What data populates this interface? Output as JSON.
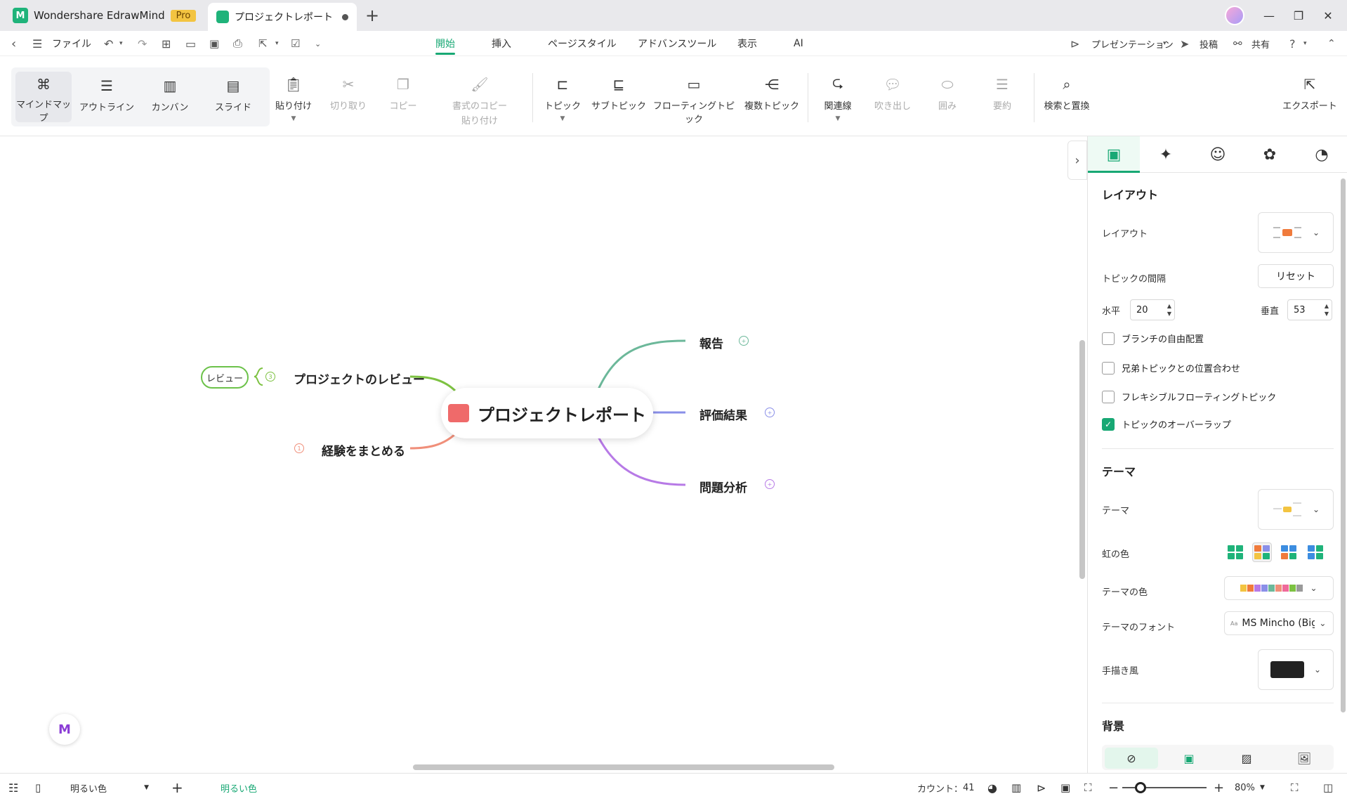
{
  "titlebar": {
    "app_name": "Wondershare EdrawMind",
    "pro_badge": "Pro",
    "doc_tab": "プロジェクトレポート",
    "new_tab": "+",
    "window_controls": {
      "minimize": "—",
      "restore": "❐",
      "close": "✕"
    }
  },
  "menubar": {
    "file": "ファイル",
    "tabs": [
      "開始",
      "挿入",
      "ページスタイル",
      "アドバンスツール",
      "表示",
      "AI"
    ],
    "active_tab": "開始",
    "presentation": "プレゼンテーション",
    "post": "投稿",
    "share": "共有"
  },
  "ribbon": {
    "views": [
      "マインドマップ",
      "アウトライン",
      "カンバン",
      "スライド"
    ],
    "paste": "貼り付け",
    "cut": "切り取り",
    "copy": "コピー",
    "format_copy_line1": "書式のコピー",
    "format_copy_line2": "貼り付け",
    "topic": "トピック",
    "subtopic": "サブトピック",
    "floating_topic": "フローティングトピック",
    "multiple_topics": "複数トピック",
    "relationship": "関連線",
    "callout": "吹き出し",
    "boundary": "囲み",
    "summary": "要約",
    "find_replace": "検索と置換",
    "export": "エクスポート"
  },
  "mindmap": {
    "root": "プロジェクトレポート",
    "topics": {
      "report": "報告",
      "evaluation": "評価結果",
      "analysis": "問題分析",
      "review": "プロジェクトのレビュー",
      "summary": "経験をまとめる"
    },
    "callout_label": "レビュー",
    "colors": {
      "report": "#6cb89a",
      "evaluation": "#8a8fe8",
      "analysis": "#b77ae6",
      "review": "#7dc242",
      "summary": "#f08f7a"
    }
  },
  "panel": {
    "tab_icons": [
      "layout-icon",
      "ai-sparkle-icon",
      "emoji-icon",
      "badge-icon",
      "history-icon"
    ],
    "layout_heading": "レイアウト",
    "layout_label": "レイアウト",
    "spacing_label": "トピックの間隔",
    "reset_button": "リセット",
    "horizontal_label": "水平",
    "horizontal_value": "20",
    "vertical_label": "垂直",
    "vertical_value": "53",
    "checkboxes": [
      {
        "label": "ブランチの自由配置",
        "checked": false
      },
      {
        "label": "兄弟トピックとの位置合わせ",
        "checked": false
      },
      {
        "label": "フレキシブルフローティングトピック",
        "checked": false
      },
      {
        "label": "トピックのオーバーラップ",
        "checked": true
      }
    ],
    "theme_heading": "テーマ",
    "theme_label": "テーマ",
    "rainbow_label": "虹の色",
    "theme_color_label": "テーマの色",
    "theme_font_label": "テーマのフォント",
    "theme_font_icon": "Aa",
    "theme_font_value": "MS Mincho (Big",
    "handdrawn_label": "手描き風",
    "background_heading": "背景"
  },
  "statusbar": {
    "theme_select": "明るい色",
    "theme_tab": "明るい色",
    "count_label": "カウント：",
    "count_value": "41",
    "zoom_value": "80%"
  }
}
